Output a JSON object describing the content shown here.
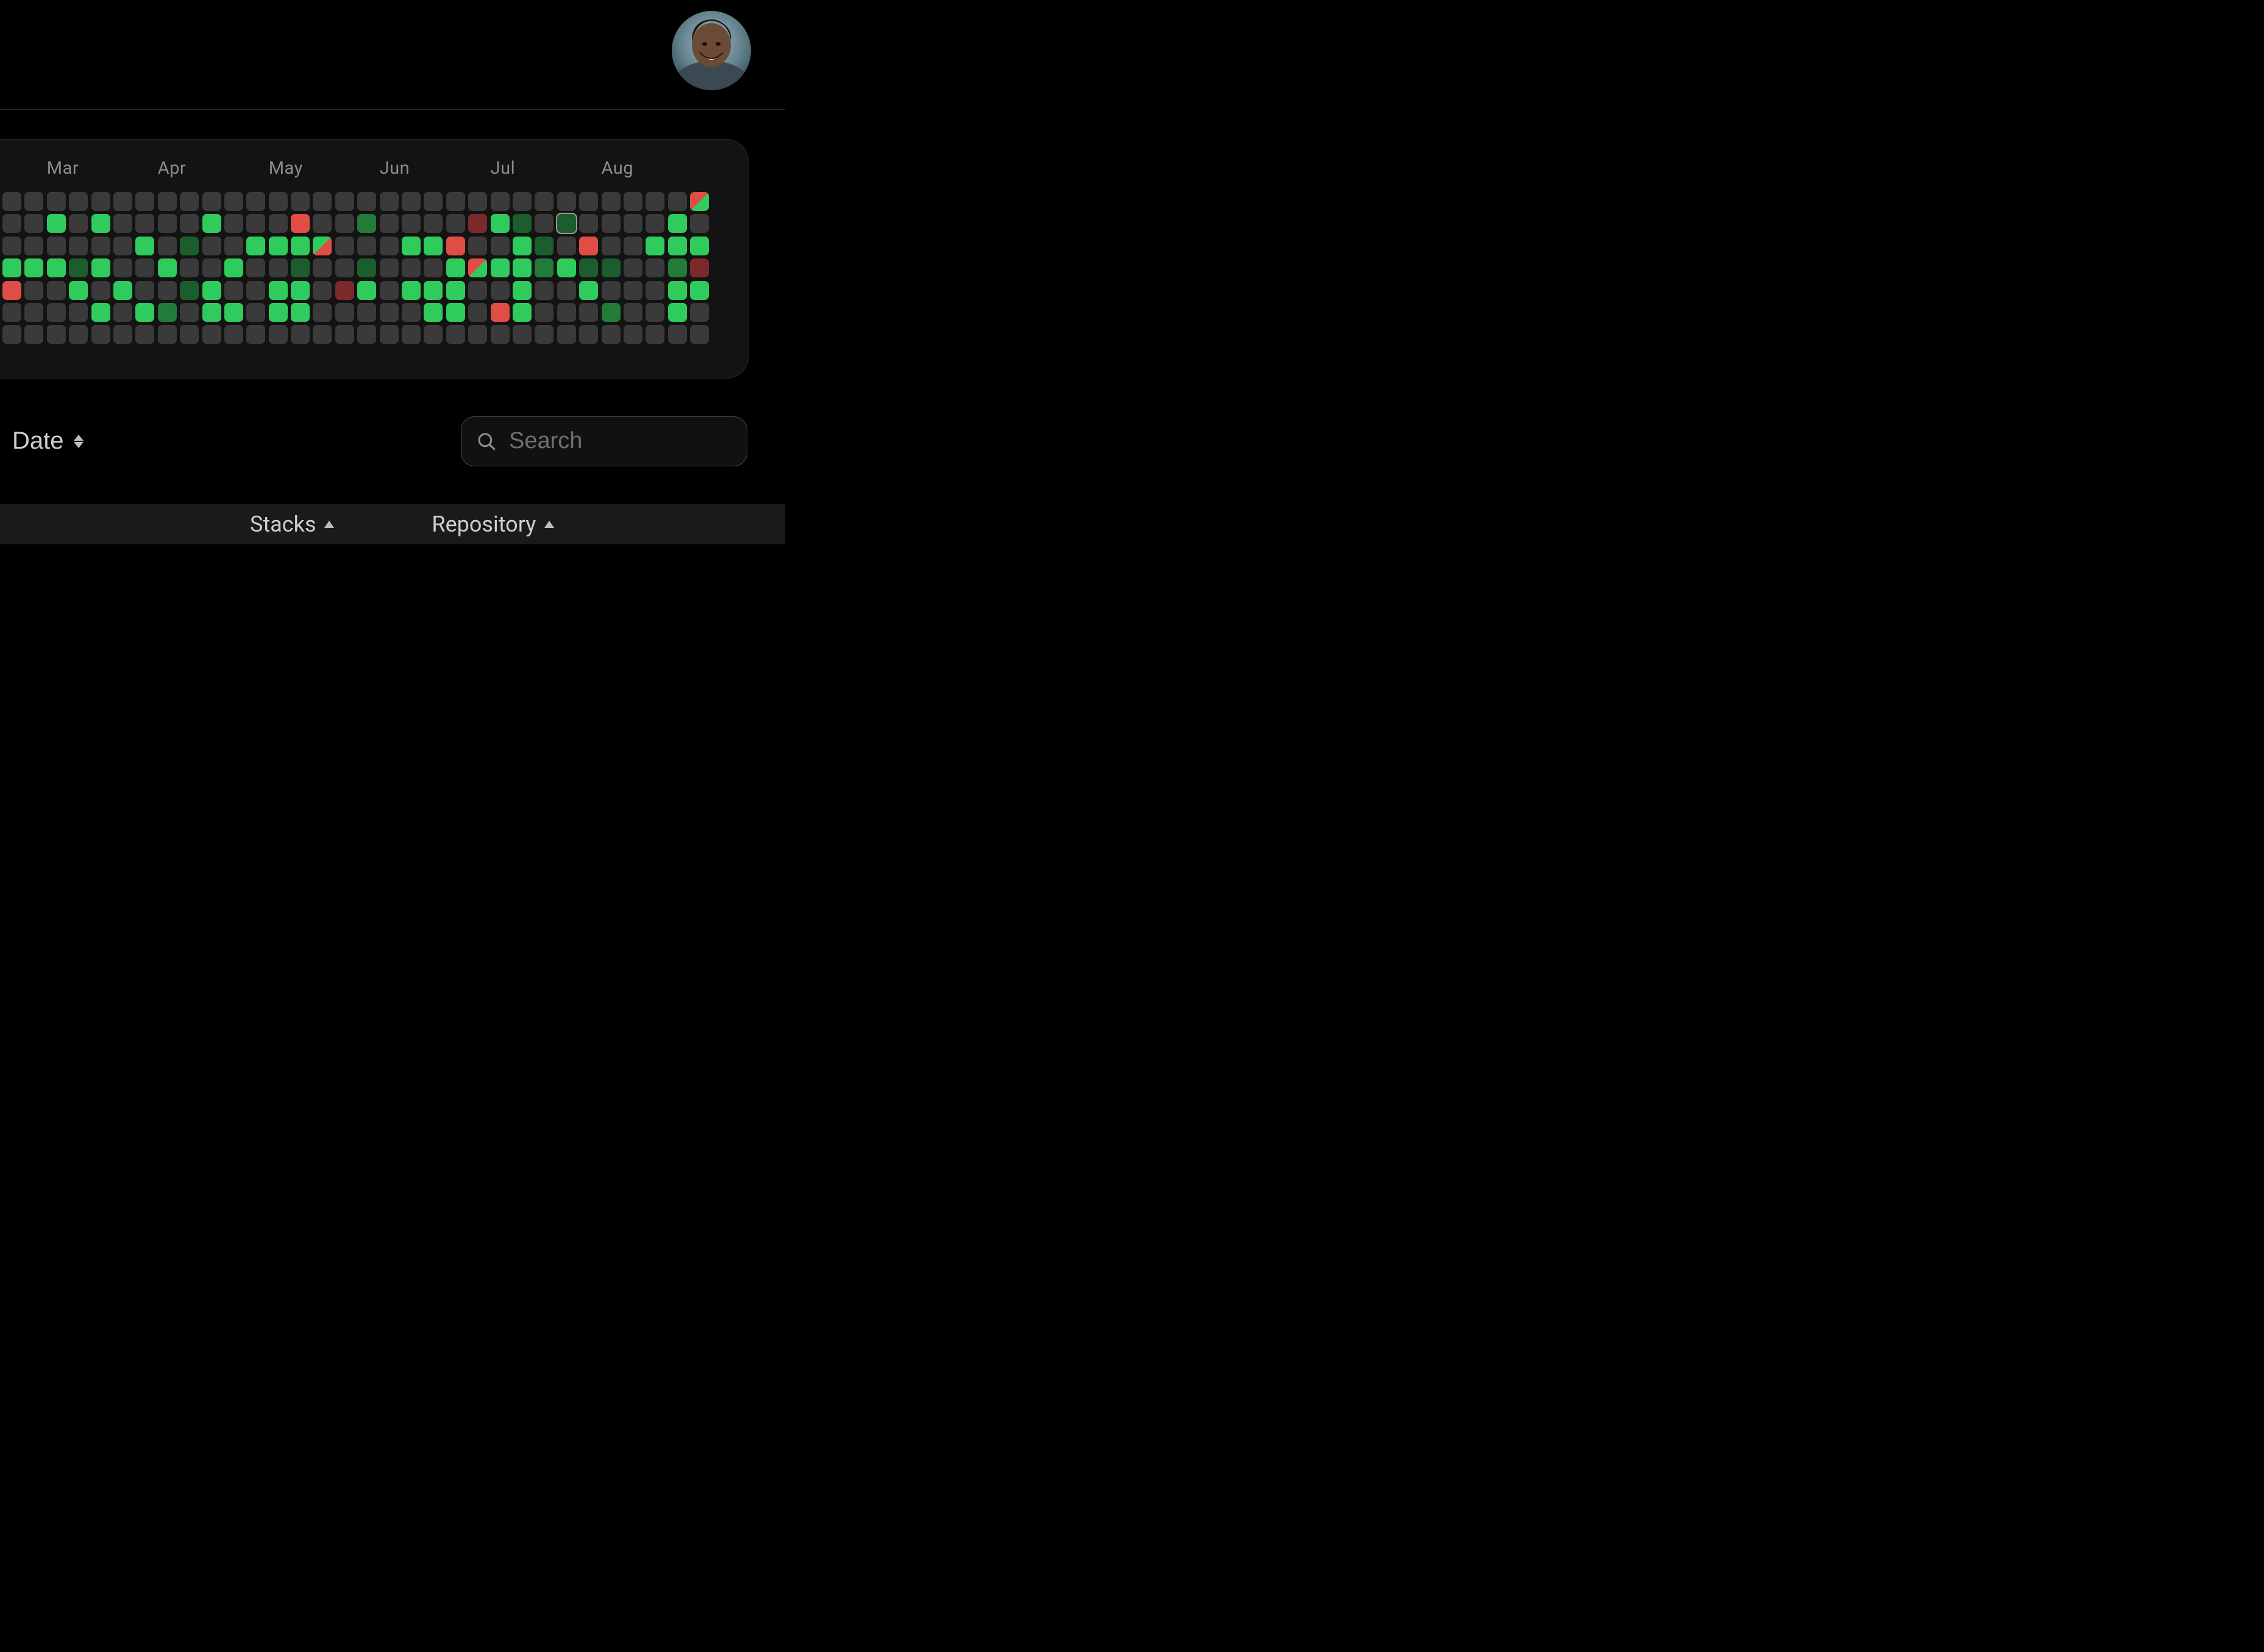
{
  "header": {
    "avatar_alt": "user-avatar"
  },
  "heatmap": {
    "months": [
      "Mar",
      "Apr",
      "May",
      "Jun",
      "Jul",
      "Aug"
    ],
    "month_start_cols": [
      2,
      7,
      12,
      17,
      22,
      27
    ],
    "weeks": 32,
    "rows": 7,
    "cells": [
      [
        "",
        "",
        "",
        "",
        "",
        "",
        "",
        "",
        "",
        "",
        "",
        "",
        "",
        "",
        "",
        "",
        "",
        "",
        "",
        "",
        "",
        "",
        "",
        "",
        "",
        "",
        "",
        "",
        "",
        "",
        "",
        "split-rg"
      ],
      [
        "",
        "",
        "g3",
        "",
        "g3",
        "",
        "",
        "",
        "",
        "g3",
        "",
        "",
        "",
        "r2",
        "",
        "",
        "g2",
        "",
        "",
        "",
        "",
        "r1",
        "g3",
        "g1",
        "",
        "sel",
        "",
        "",
        "",
        "",
        "g3",
        ""
      ],
      [
        "",
        "",
        "",
        "",
        "",
        "",
        "g3",
        "",
        "g1",
        "",
        "",
        "g3",
        "g3",
        "g3",
        "split-gr",
        "",
        "",
        "",
        "g3",
        "g3",
        "r2",
        "",
        "",
        "g3",
        "g1",
        "",
        "r2",
        "",
        "",
        "g3",
        "g3",
        "g3"
      ],
      [
        "g3",
        "g3",
        "g3",
        "g1",
        "g3",
        "",
        "",
        "g3",
        "",
        "",
        "g3",
        "",
        "",
        "g1",
        "",
        "",
        "g1",
        "",
        "",
        "",
        "g3",
        "split-rg",
        "g3",
        "g3",
        "g2",
        "g3",
        "g1",
        "g1",
        "",
        "",
        "g2",
        "r1"
      ],
      [
        "r2",
        "",
        "",
        "g3",
        "",
        "g3",
        "",
        "",
        "g1",
        "g3",
        "",
        "",
        "g3",
        "g3",
        "",
        "r1",
        "g3",
        "",
        "g3",
        "g3",
        "g3",
        "",
        "",
        "g3",
        "",
        "",
        "g3",
        "",
        "",
        "",
        "g3",
        "g3"
      ],
      [
        "",
        "",
        "",
        "",
        "g3",
        "",
        "g3",
        "g2",
        "",
        "g3",
        "g3",
        "",
        "g3",
        "g3",
        "",
        "",
        "",
        "",
        "",
        "g3",
        "g3",
        "",
        "r2",
        "g3",
        "",
        "",
        "",
        "g2",
        "",
        "",
        "g3",
        ""
      ],
      [
        "",
        "",
        "",
        "",
        "",
        "",
        "",
        "",
        "",
        "",
        "",
        "",
        "",
        "",
        "",
        "",
        "",
        "",
        "",
        "",
        "",
        "",
        "",
        "",
        "",
        "",
        "",
        "",
        "",
        "",
        "",
        ""
      ]
    ]
  },
  "filters": {
    "date_label": "Date",
    "search_placeholder": "Search"
  },
  "table": {
    "columns": {
      "stacks": "Stacks",
      "repository": "Repository"
    }
  }
}
